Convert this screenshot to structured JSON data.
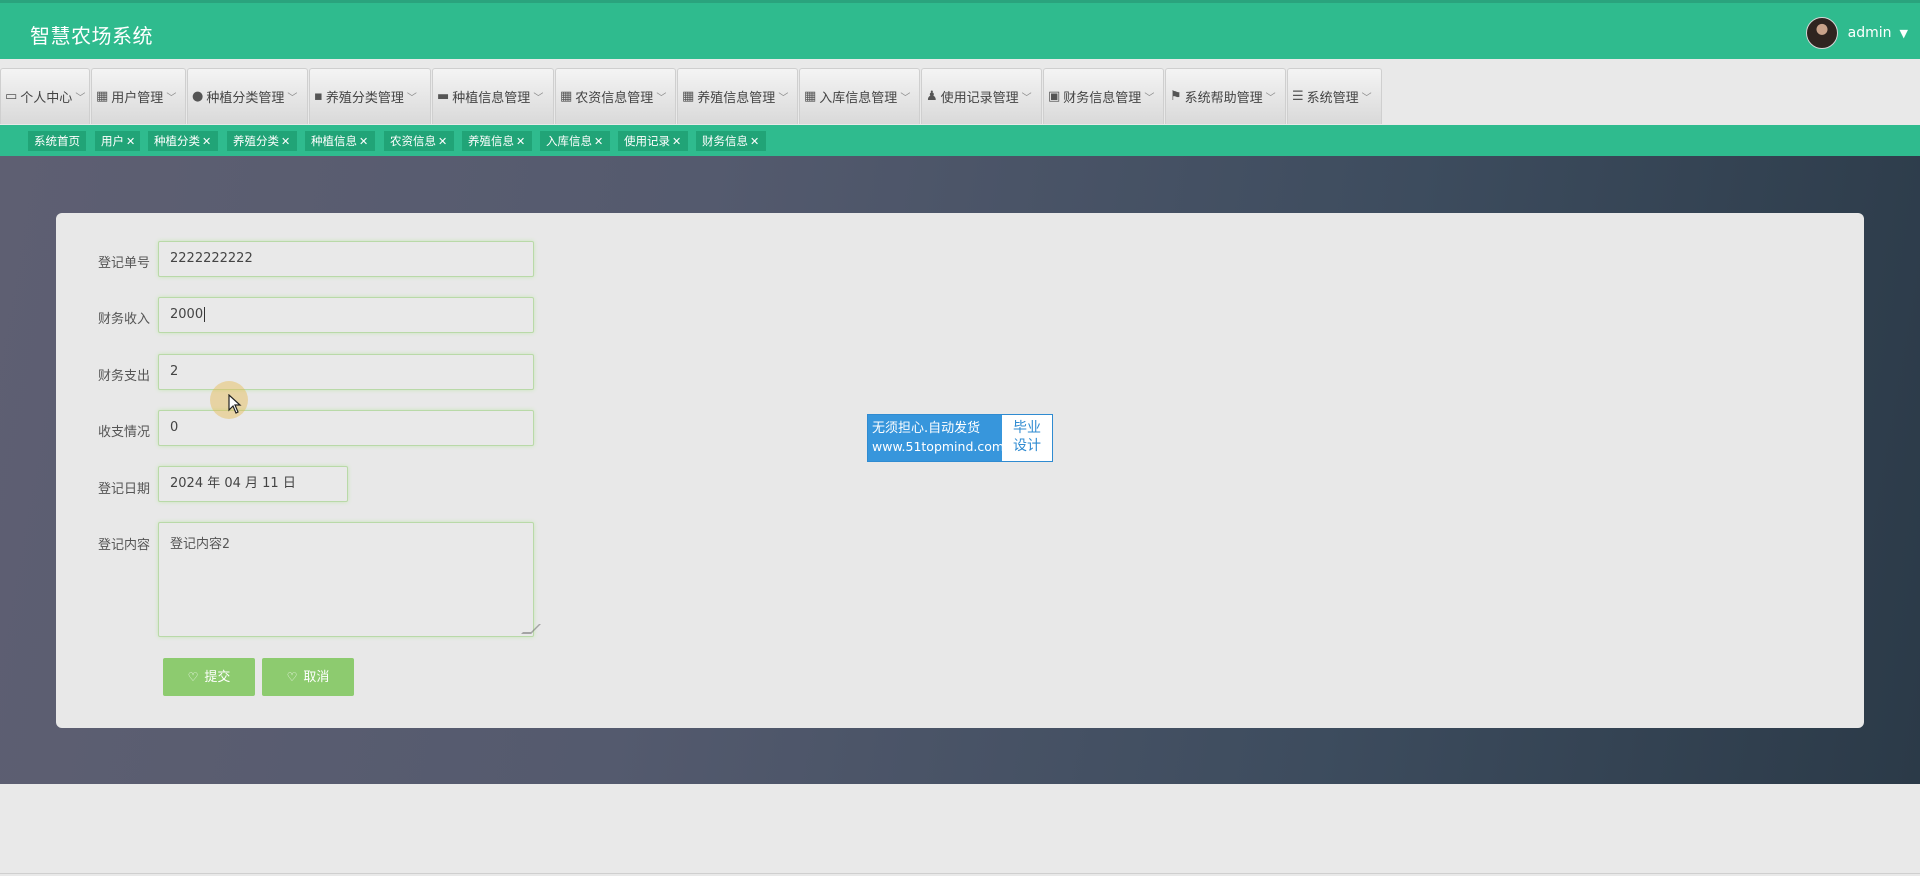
{
  "app": {
    "title": "智慧农场系统",
    "user": "admin"
  },
  "menu": [
    {
      "label": "个人中心",
      "icon": "profile-icon"
    },
    {
      "label": "用户管理",
      "icon": "grid-icon"
    },
    {
      "label": "种植分类管理",
      "icon": "bulb-icon"
    },
    {
      "label": "养殖分类管理",
      "icon": "comment-icon"
    },
    {
      "label": "种植信息管理",
      "icon": "monitor-icon"
    },
    {
      "label": "农资信息管理",
      "icon": "grid-icon"
    },
    {
      "label": "养殖信息管理",
      "icon": "grid-icon"
    },
    {
      "label": "入库信息管理",
      "icon": "grid-icon"
    },
    {
      "label": "使用记录管理",
      "icon": "stamp-icon"
    },
    {
      "label": "财务信息管理",
      "icon": "clipboard-icon"
    },
    {
      "label": "系统帮助管理",
      "icon": "flag-icon"
    },
    {
      "label": "系统管理",
      "icon": "list-icon"
    }
  ],
  "tabs": [
    {
      "label": "系统首页",
      "closable": false
    },
    {
      "label": "用户",
      "closable": true
    },
    {
      "label": "种植分类",
      "closable": true
    },
    {
      "label": "养殖分类",
      "closable": true
    },
    {
      "label": "种植信息",
      "closable": true
    },
    {
      "label": "农资信息",
      "closable": true
    },
    {
      "label": "养殖信息",
      "closable": true
    },
    {
      "label": "入库信息",
      "closable": true
    },
    {
      "label": "使用记录",
      "closable": true
    },
    {
      "label": "财务信息",
      "closable": true
    }
  ],
  "tab_close_symbol": "✕",
  "form": {
    "fields": [
      {
        "label": "登记单号",
        "value": "2222222222"
      },
      {
        "label": "财务收入",
        "value": "2000"
      },
      {
        "label": "财务支出",
        "value": "2"
      },
      {
        "label": "收支情况",
        "value": "0"
      },
      {
        "label": "登记日期",
        "value": "2024 年 04 月 11 日"
      },
      {
        "label": "登记内容",
        "value": "登记内容2"
      }
    ],
    "submit_label": "提交",
    "cancel_label": "取消"
  },
  "watermark": {
    "line1": "无须担心.自动发货",
    "line2": "www.51topmind.com",
    "right1": "毕业",
    "right2": "设计"
  },
  "colors": {
    "primary": "#2fbb8e",
    "tab_bg": "#21a477",
    "button": "#8dcb6f"
  }
}
